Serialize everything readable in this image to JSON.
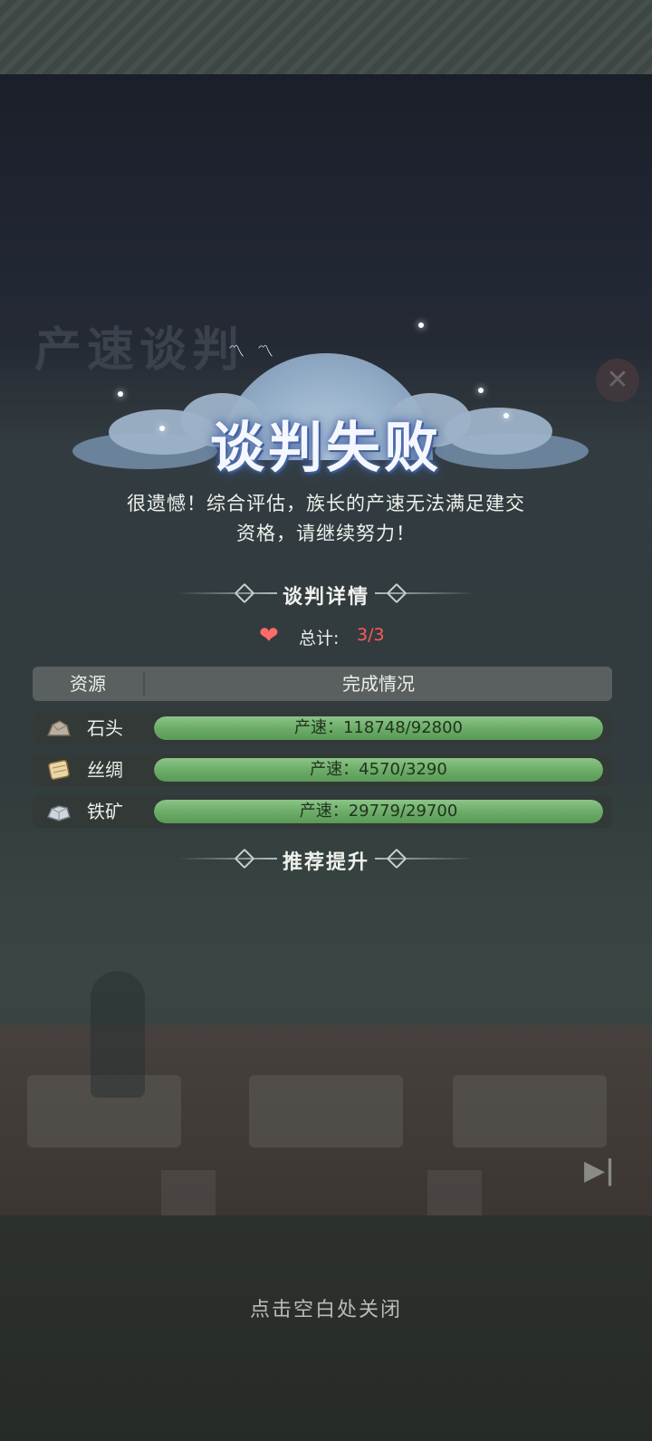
{
  "background": {
    "title": "产速谈判"
  },
  "result": {
    "title": "谈判失败",
    "message": "很遗憾！综合评估，族长的产速无法满足建交资格，请继续努力！"
  },
  "details": {
    "section_title": "谈判详情",
    "total_label": "总计:",
    "total_value": "3/3",
    "total_icon": "heart-icon",
    "columns": [
      "资源",
      "完成情况"
    ],
    "rows": [
      {
        "icon": "stone-icon",
        "name": "石头",
        "status": "产速：118748/92800",
        "progress": 1.0
      },
      {
        "icon": "silk-icon",
        "name": "丝绸",
        "status": "产速：4570/3290",
        "progress": 1.0
      },
      {
        "icon": "iron-ore-icon",
        "name": "铁矿",
        "status": "产速：29779/29700",
        "progress": 1.0
      }
    ]
  },
  "recommend": {
    "section_title": "推荐提升"
  },
  "footer": {
    "close_hint": "点击空白处关闭"
  },
  "colors": {
    "bar_fill": "#6aab66",
    "heart": "#ff6b6b",
    "total_value": "#ff5a5a"
  }
}
